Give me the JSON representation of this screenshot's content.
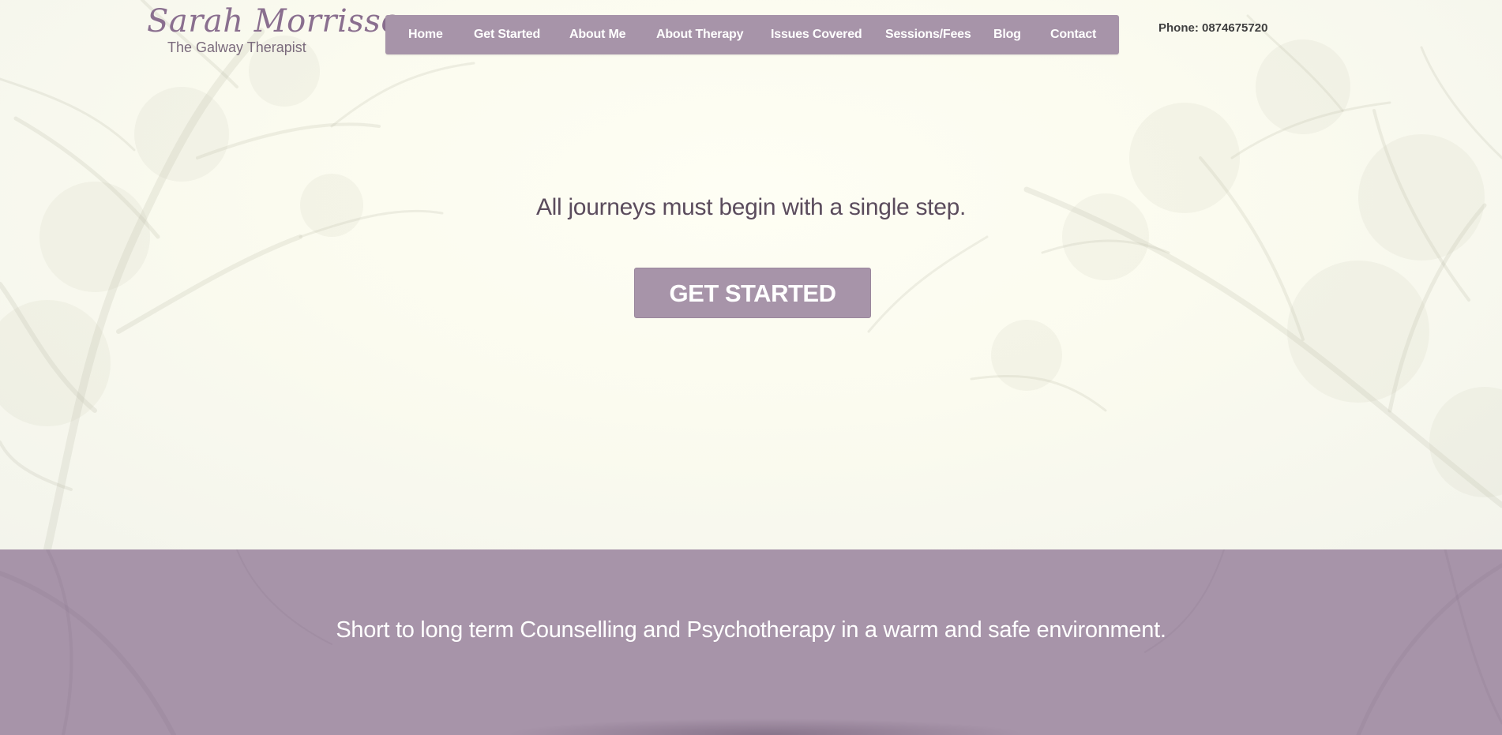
{
  "brand": {
    "name": "Sarah Morrissey",
    "tagline": "The Galway Therapist"
  },
  "nav": {
    "items": [
      {
        "label": "Home"
      },
      {
        "label": "Get Started"
      },
      {
        "label": "About Me"
      },
      {
        "label": "About Therapy"
      },
      {
        "label": "Issues Covered"
      },
      {
        "label": "Sessions/Fees"
      },
      {
        "label": "Blog"
      },
      {
        "label": "Contact"
      }
    ]
  },
  "header": {
    "phone": "Phone: 0874675720"
  },
  "hero": {
    "heading": "All journeys must begin with a single step.",
    "cta_label": "GET STARTED"
  },
  "band": {
    "text": "Short to long term Counselling and Psychotherapy in a warm and safe environment."
  },
  "colors": {
    "accent": "#a794a9",
    "logo": "#8a6f8f",
    "hero_background": "#fbfbf2",
    "heading_text": "#5b4c5d",
    "phone_text": "#3f3f3f"
  },
  "icons": [
    "tree-branches-background"
  ]
}
